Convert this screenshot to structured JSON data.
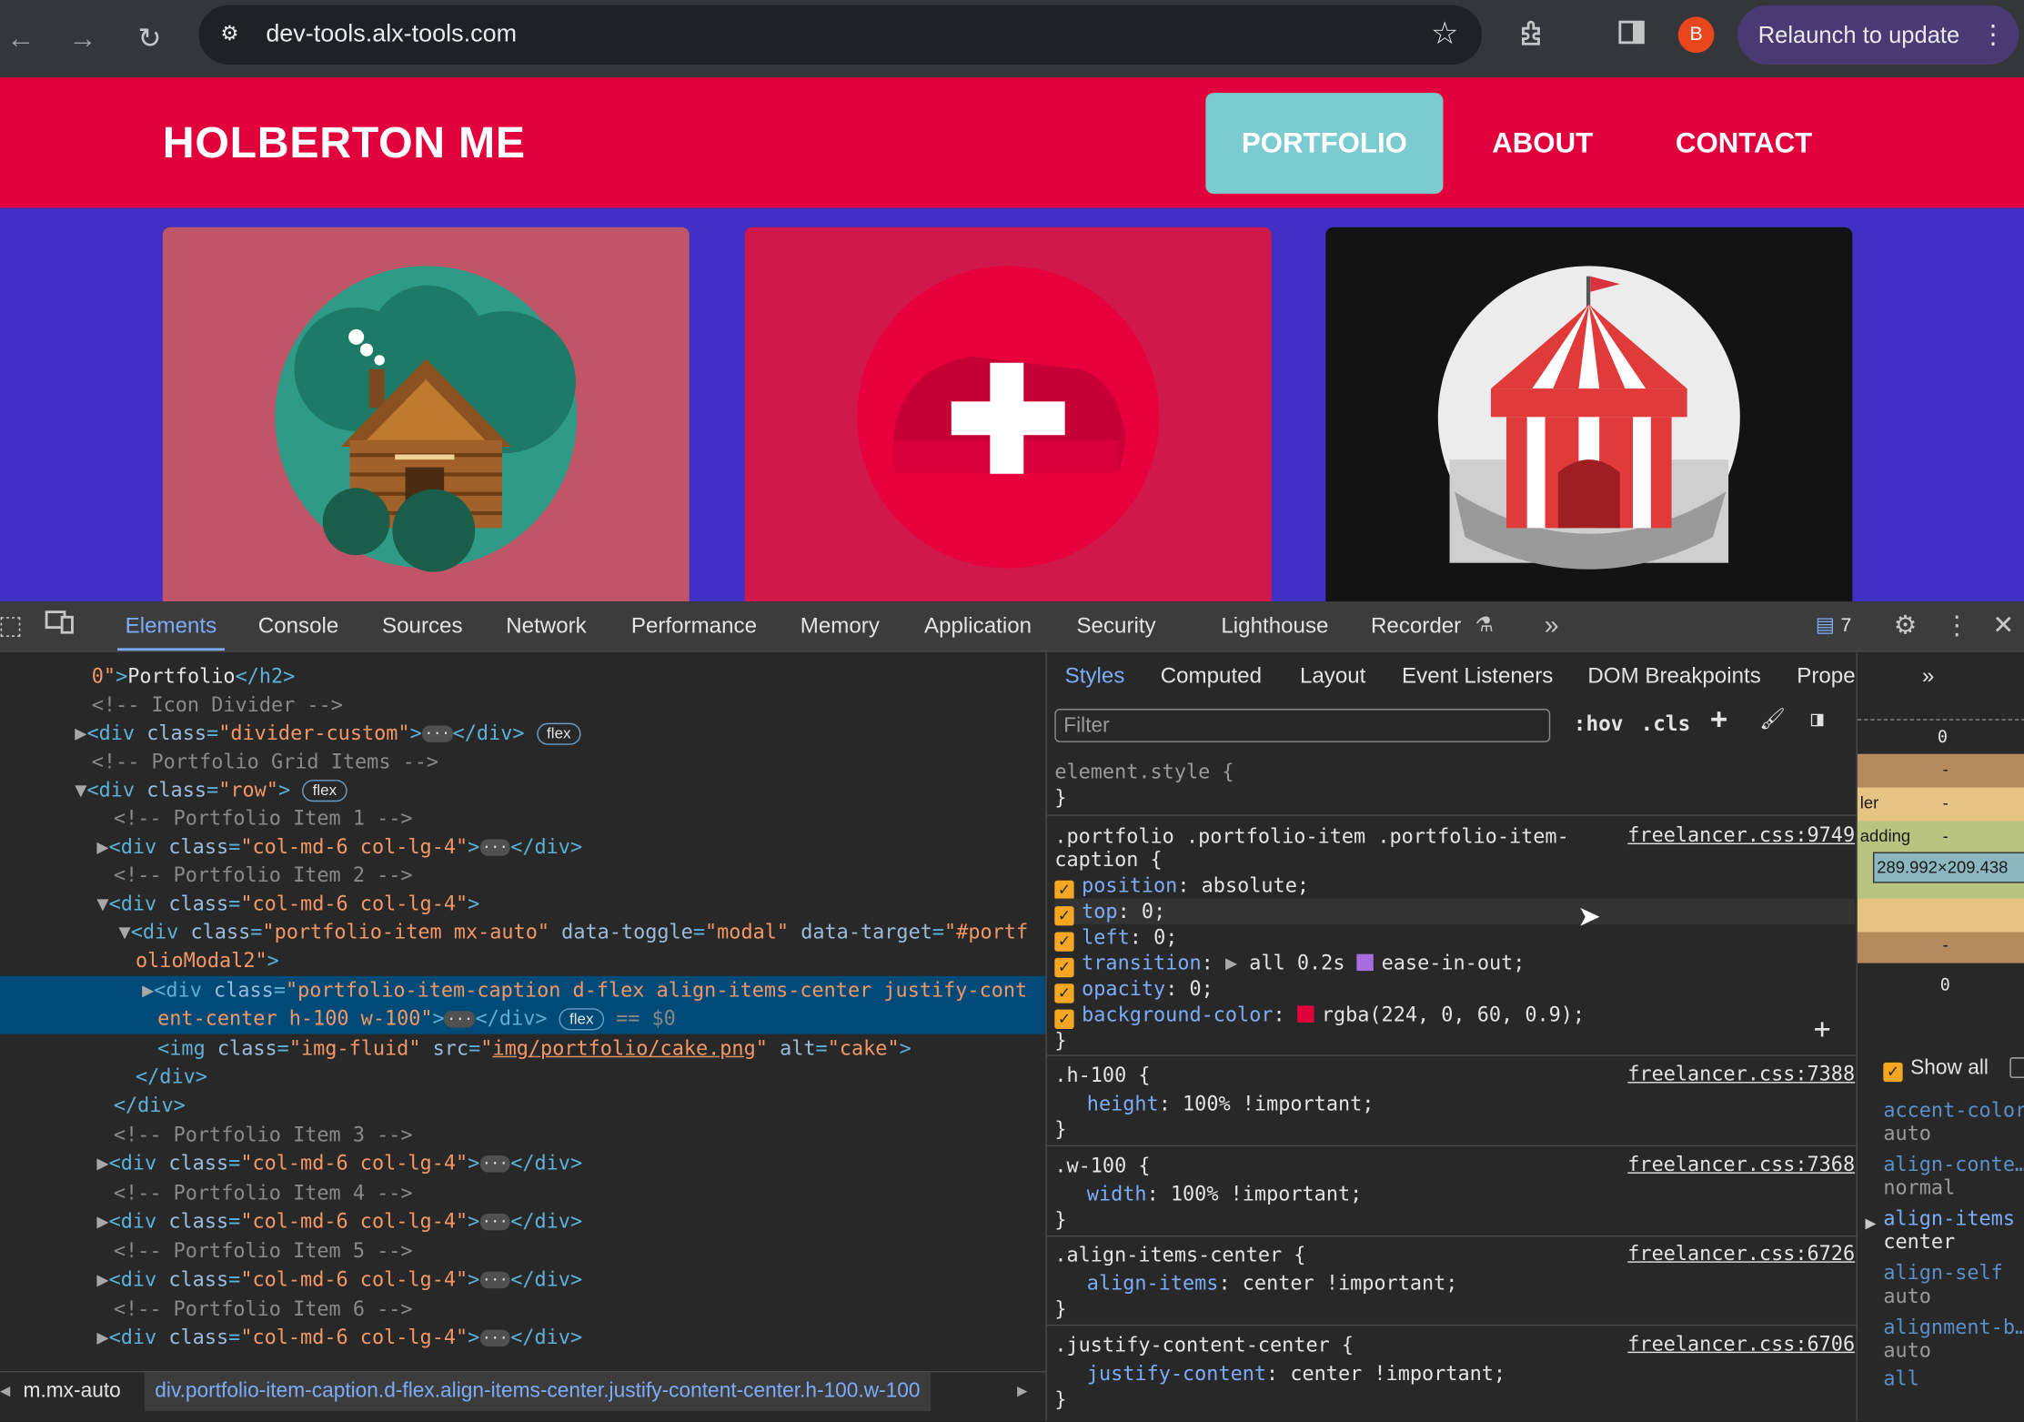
{
  "browser": {
    "url": "dev-tools.alx-tools.com",
    "profile_initial": "B",
    "relaunch_label": "Relaunch to update",
    "colors": {
      "toolbar": "#35363a",
      "relaunch": "#483a72",
      "avatar": "#e8461c"
    }
  },
  "site": {
    "brand": "HOLBERTON ME",
    "nav": [
      "PORTFOLIO",
      "ABOUT",
      "CONTACT"
    ],
    "colors": {
      "header": "#e1003c",
      "active_nav": "#7ccbd0",
      "portfolio_bg": "#4030c4"
    },
    "cards": [
      {
        "name": "cabin",
        "bg": "#c0556a"
      },
      {
        "name": "cake",
        "bg": "#d0184a"
      },
      {
        "name": "circus",
        "bg": "#131313"
      }
    ]
  },
  "devtools": {
    "tabs": [
      "Elements",
      "Console",
      "Sources",
      "Network",
      "Performance",
      "Memory",
      "Application",
      "Security",
      "Lighthouse",
      "Recorder"
    ],
    "issues_count": "7",
    "elements": {
      "l0": {
        "text": "Portfolio"
      },
      "l1": "<!-- Icon Divider -->",
      "l2": {
        "open": "<div",
        "attr": "class",
        "value": "\"divider-custom\"",
        "close": "</div>",
        "badge": "flex"
      },
      "l3": "<!-- Portfolio Grid Items -->",
      "l4": {
        "open": "<div",
        "attr": "class",
        "value": "\"row\"",
        "badge": "flex"
      },
      "l5": "<!-- Portfolio Item 1 -->",
      "l6": {
        "open": "<div",
        "attr": "class",
        "value": "\"col-md-6 col-lg-4\"",
        "close": "</div>"
      },
      "l7": "<!-- Portfolio Item 2 -->",
      "l8": {
        "open": "<div",
        "attr": "class",
        "value": "\"col-md-6 col-lg-4\""
      },
      "l9": {
        "open": "<div",
        "attr1": "class",
        "val1": "\"portfolio-item mx-auto\"",
        "attr2": "data-toggle",
        "val2": "\"modal\"",
        "attr3": "data-target",
        "val3a": "\"#portf",
        "val3b": "olioModal2\""
      },
      "l10": {
        "open": "<div",
        "attr": "class",
        "val_a": "\"portfolio-item-caption d-flex align-items-center justify-cont",
        "val_b": "ent-center h-100 w-100\"",
        "close": "</div>",
        "badge": "flex",
        "marker": "== $0"
      },
      "l11": {
        "open": "<img",
        "attr1": "class",
        "val1": "\"img-fluid\"",
        "attr2": "src",
        "link": "img/portfolio/cake.png",
        "attr3": "alt",
        "val3": "\"cake\""
      },
      "l12": "</div>",
      "l13": "</div>",
      "l14": "<!-- Portfolio Item 3 -->",
      "l15": {
        "open": "<div",
        "attr": "class",
        "value": "\"col-md-6 col-lg-4\"",
        "close": "</div>"
      },
      "l16": "<!-- Portfolio Item 4 -->",
      "l17": {
        "open": "<div",
        "attr": "class",
        "value": "\"col-md-6 col-lg-4\"",
        "close": "</div>"
      },
      "l18": "<!-- Portfolio Item 5 -->",
      "l19": {
        "open": "<div",
        "attr": "class",
        "value": "\"col-md-6 col-lg-4\"",
        "close": "</div>"
      },
      "l20": "<!-- Portfolio Item 6 -->",
      "l21": {
        "open": "<div",
        "attr": "class",
        "value": "\"col-md-6 col-lg-4\"",
        "close": "</div>"
      }
    },
    "breadcrumbs": [
      "m.mx-auto",
      "div.portfolio-item-caption.d-flex.align-items-center.justify-content-center.h-100.w-100"
    ],
    "styles": {
      "sub_tabs": [
        "Styles",
        "Computed",
        "Layout",
        "Event Listeners",
        "DOM Breakpoints",
        "Properties"
      ],
      "filter_placeholder": "Filter",
      "hov": ":hov",
      "cls": ".cls",
      "element_style": "element.style {",
      "rule1": {
        "selector_a": ".portfolio .portfolio-item .portfolio-item-",
        "selector_b": "caption {",
        "source": "freelancer.css:9749",
        "props": [
          {
            "name": "position",
            "value": "absolute;"
          },
          {
            "name": "top",
            "value": "0;"
          },
          {
            "name": "left",
            "value": "0;"
          },
          {
            "name": "transition",
            "value_a": "all 0.2s",
            "value_b": "ease-in-out;"
          },
          {
            "name": "opacity",
            "value": "0;"
          },
          {
            "name": "background-color",
            "value": "rgba(224, 0, 60, 0.9);",
            "swatch": "#e0003c"
          }
        ]
      },
      "rule2": {
        "selector": ".h-100 {",
        "source": "freelancer.css:7388",
        "prop": "height",
        "value": "100% !important;"
      },
      "rule3": {
        "selector": ".w-100 {",
        "source": "freelancer.css:7368",
        "prop": "width",
        "value": "100% !important;"
      },
      "rule4": {
        "selector": ".align-items-center {",
        "source": "freelancer.css:6726",
        "prop": "align-items",
        "value": "center !important;"
      },
      "rule5": {
        "selector": ".justify-content-center {",
        "source": "freelancer.css:6706",
        "prop": "justify-content",
        "value": "center !important;"
      }
    },
    "box_model": {
      "margin_top": "0",
      "margin_bottom": "0",
      "border_label": "ler",
      "padding_label": "adding",
      "dash": "-",
      "content_size": "289.992×209.438"
    },
    "computed": {
      "show_all": "Show all",
      "items": [
        {
          "name": "accent-color",
          "value": "auto"
        },
        {
          "name": "align-conte…",
          "value": "normal"
        },
        {
          "name": "align-items",
          "value": "center"
        },
        {
          "name": "align-self",
          "value": "auto"
        },
        {
          "name": "alignment-b…",
          "value": "auto"
        },
        {
          "name": "all",
          "value": ""
        }
      ]
    }
  }
}
